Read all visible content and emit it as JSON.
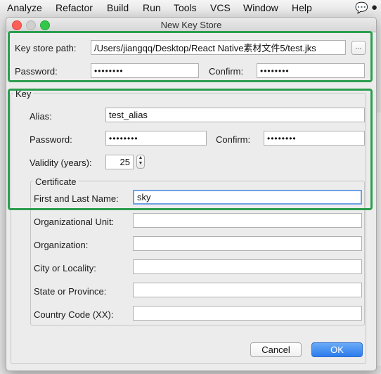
{
  "menubar": {
    "items": [
      "Analyze",
      "Refactor",
      "Build",
      "Run",
      "Tools",
      "VCS",
      "Window",
      "Help"
    ]
  },
  "dialog": {
    "title": "New Key Store",
    "keystore": {
      "path_label": "Key store path:",
      "path_value": "/Users/jiangqq/Desktop/React Native素材文件5/test.jks",
      "browse_label": "...",
      "password_label": "Password:",
      "password_value": "••••••••",
      "confirm_label": "Confirm:",
      "confirm_value": "••••••••"
    },
    "key": {
      "group_title": "Key",
      "alias_label": "Alias:",
      "alias_value": "test_alias",
      "password_label": "Password:",
      "password_value": "••••••••",
      "confirm_label": "Confirm:",
      "confirm_value": "••••••••",
      "validity_label": "Validity (years):",
      "validity_value": "25"
    },
    "certificate": {
      "group_title": "Certificate",
      "first_last_label": "First and Last Name:",
      "first_last_value": "sky",
      "org_unit_label": "Organizational Unit:",
      "org_unit_value": "",
      "organization_label": "Organization:",
      "organization_value": "",
      "city_label": "City or Locality:",
      "city_value": "",
      "state_label": "State or Province:",
      "state_value": "",
      "country_label": "Country Code (XX):",
      "country_value": ""
    },
    "buttons": {
      "cancel": "Cancel",
      "ok": "OK"
    }
  },
  "colors": {
    "highlight_box": "#2c9e4f",
    "ok_button": "#2b7cec",
    "close": "#fc5f57",
    "maximize": "#34c84a"
  }
}
